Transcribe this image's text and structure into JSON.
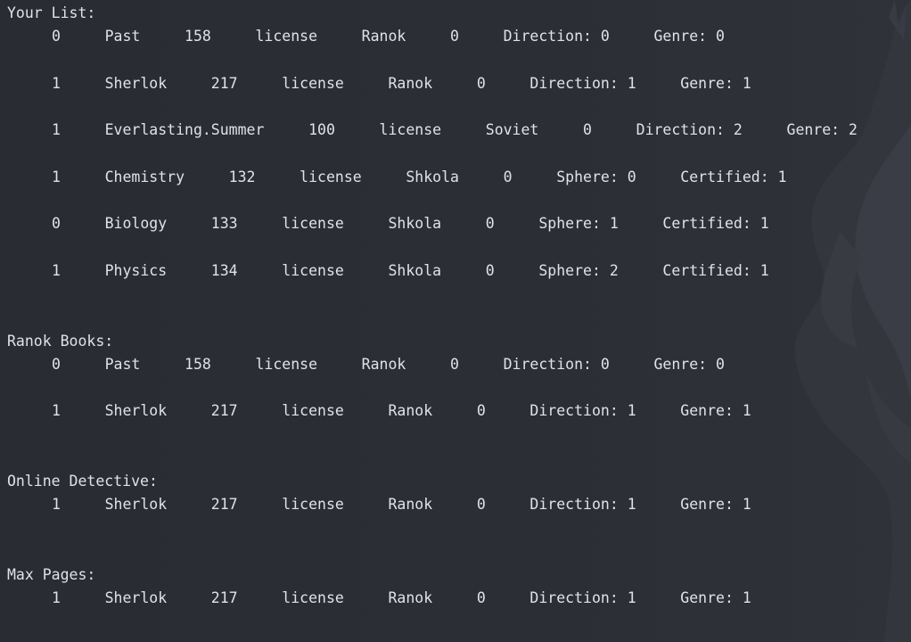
{
  "sections": [
    {
      "title": "Your List:",
      "rows": [
        "0     Past     158     license     Ranok     0     Direction: 0     Genre: 0",
        "1     Sherlok     217     license     Ranok     0     Direction: 1     Genre: 1",
        "1     Everlasting.Summer     100     license     Soviet     0     Direction: 2     Genre: 2",
        "1     Chemistry     132     license     Shkola     0     Sphere: 0     Certified: 1",
        "0     Biology     133     license     Shkola     0     Sphere: 1     Certified: 1",
        "1     Physics     134     license     Shkola     0     Sphere: 2     Certified: 1"
      ]
    },
    {
      "title": "Ranok Books:",
      "rows": [
        "0     Past     158     license     Ranok     0     Direction: 0     Genre: 0",
        "1     Sherlok     217     license     Ranok     0     Direction: 1     Genre: 1"
      ]
    },
    {
      "title": "Online Detective:",
      "rows": [
        "1     Sherlok     217     license     Ranok     0     Direction: 1     Genre: 1"
      ]
    },
    {
      "title": "Max Pages:",
      "rows": [
        "1     Sherlok     217     license     Ranok     0     Direction: 1     Genre: 1"
      ]
    }
  ],
  "colors": {
    "background": "#2b2d35",
    "text": "#dfe2e8",
    "art": "#3a3c44"
  },
  "icons": {
    "background_art": "demon-silhouette-wallpaper"
  }
}
